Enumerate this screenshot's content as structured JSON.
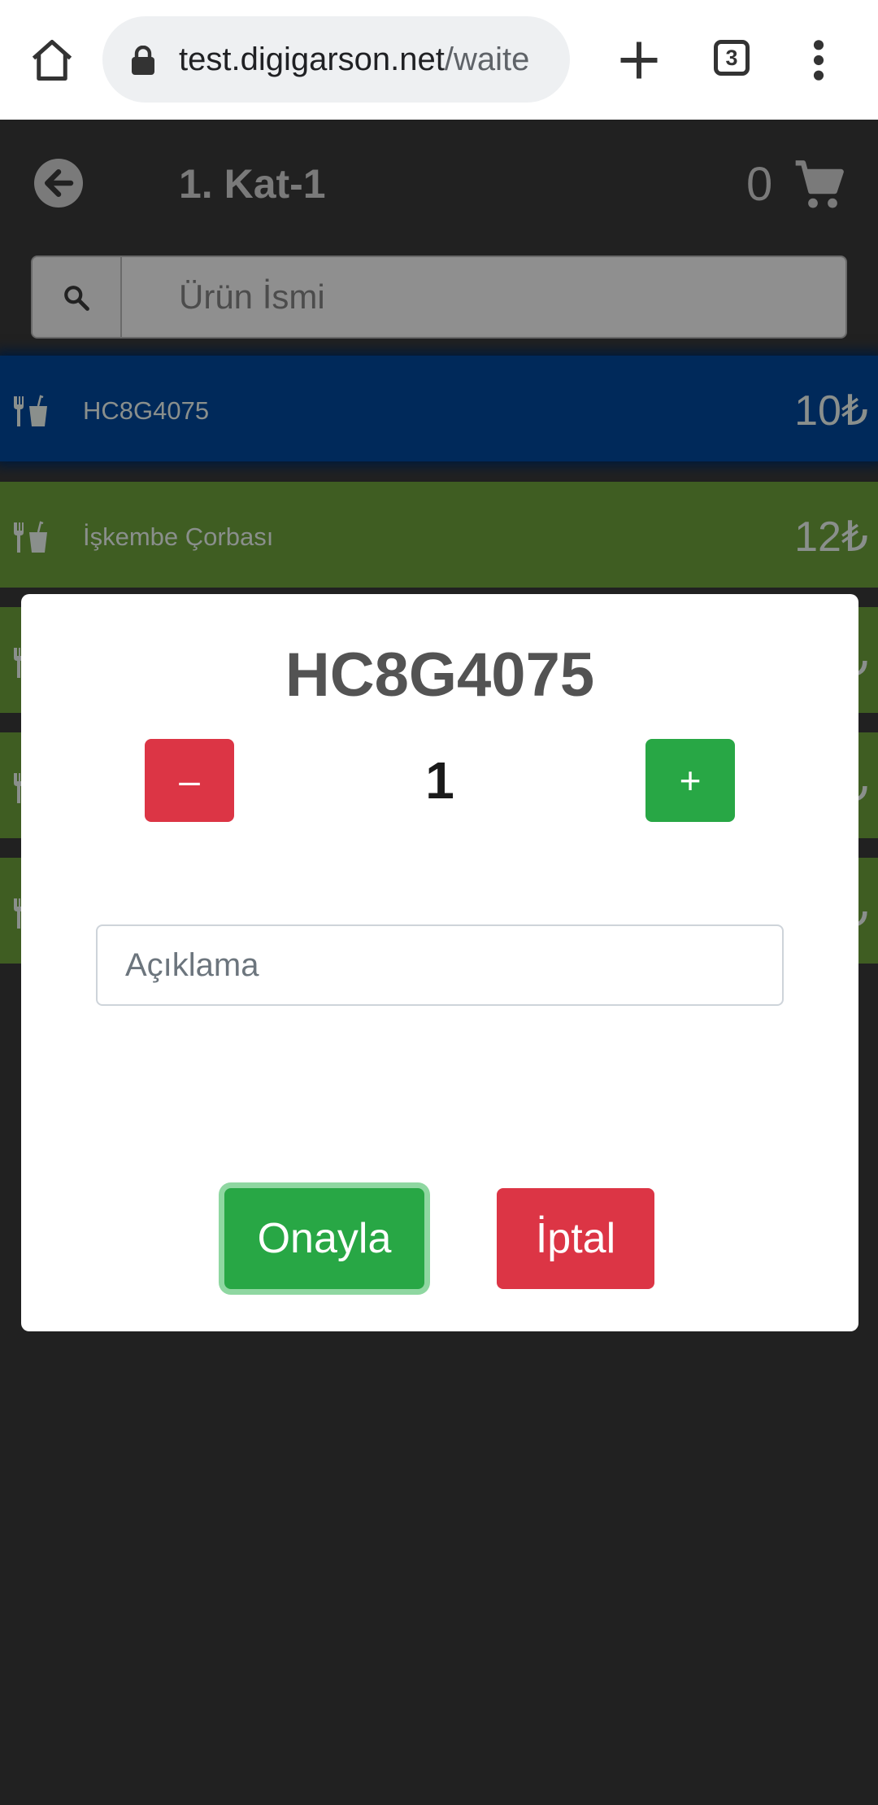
{
  "browser": {
    "url_host": "test.digigarson.net",
    "url_path": "/waite",
    "tab_count": "3"
  },
  "header": {
    "title": "1. Kat-1",
    "cart_count": "0"
  },
  "search": {
    "placeholder": "Ürün İsmi"
  },
  "products": [
    {
      "name": "HC8G4075",
      "price": "10₺",
      "color": "#00295a"
    },
    {
      "name": "İşkembe Çorbası",
      "price": "12₺",
      "color": "#3f5d22"
    },
    {
      "name": "",
      "price": "₺",
      "color": "#3f5d22"
    },
    {
      "name": "",
      "price": "₺",
      "color": "#3f5d22"
    },
    {
      "name": "",
      "price": "₺",
      "color": "#3f5d22"
    }
  ],
  "modal": {
    "title": "HC8G4075",
    "minus_label": "–",
    "quantity": "1",
    "plus_label": "+",
    "note_placeholder": "Açıklama",
    "confirm_label": "Onayla",
    "cancel_label": "İptal"
  },
  "colors": {
    "confirm": "#28a745",
    "cancel": "#dc3545",
    "header_bg": "#212121"
  }
}
